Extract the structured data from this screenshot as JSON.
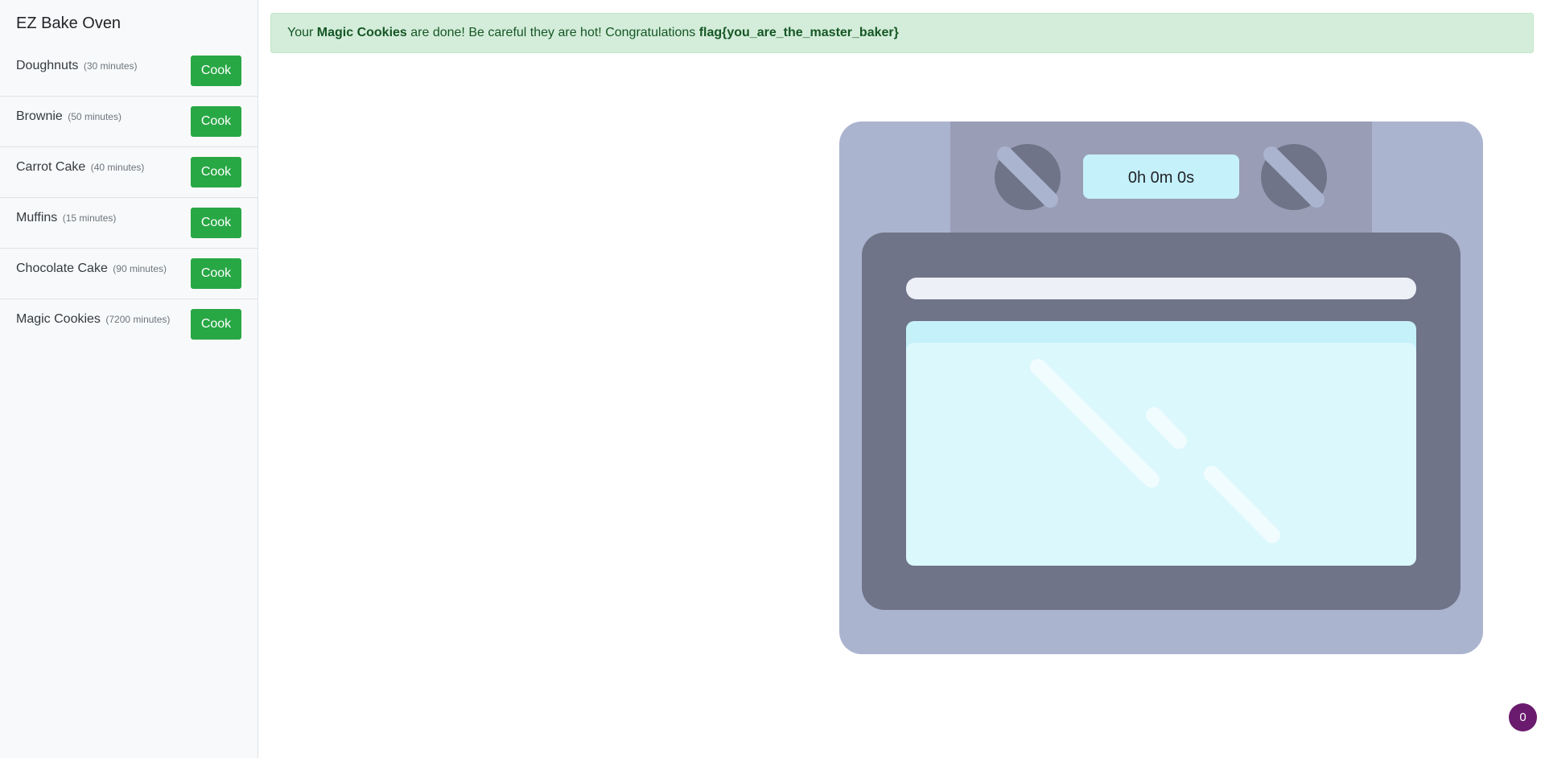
{
  "app": {
    "title": "EZ Bake Oven"
  },
  "menu": {
    "items": [
      {
        "name": "Doughnuts",
        "time": "(30 minutes)",
        "button": "Cook"
      },
      {
        "name": "Brownie",
        "time": "(50 minutes)",
        "button": "Cook"
      },
      {
        "name": "Carrot Cake",
        "time": "(40 minutes)",
        "button": "Cook"
      },
      {
        "name": "Muffins",
        "time": "(15 minutes)",
        "button": "Cook"
      },
      {
        "name": "Chocolate Cake",
        "time": "(90 minutes)",
        "button": "Cook"
      },
      {
        "name": "Magic Cookies",
        "time": "(7200 minutes)",
        "button": "Cook"
      }
    ]
  },
  "alert": {
    "prefix": "Your ",
    "item": "Magic Cookies",
    "middle": " are done! Be careful they are hot! Congratulations ",
    "flag": "flag{you_are_the_master_baker}"
  },
  "oven": {
    "timer": "0h 0m 0s",
    "colors": {
      "body": "#abb4cf",
      "panel": "#9a9db6",
      "knob": "#6f7488",
      "knob_line": "#abb4cf",
      "door": "#6f7488",
      "handle": "#edf0f7",
      "window": "#dbf8fd",
      "window_top": "#c5f1fb",
      "display": "#c5f1fb"
    }
  },
  "badge": {
    "count": "0"
  }
}
